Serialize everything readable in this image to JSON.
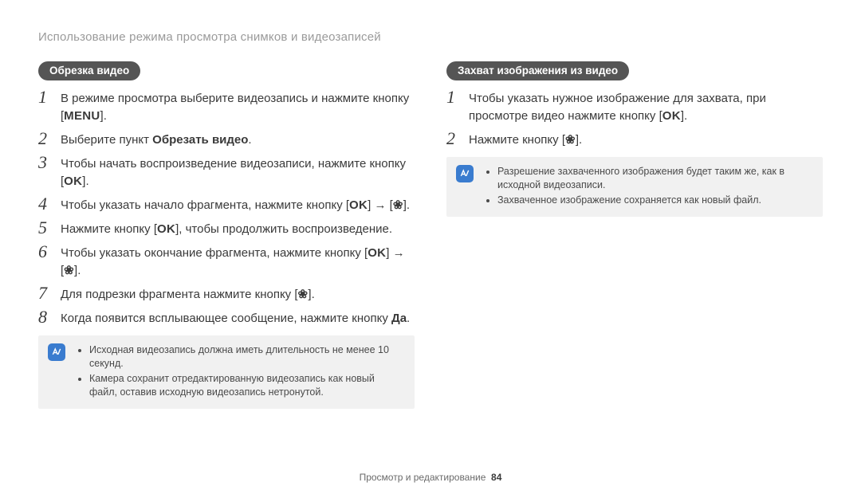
{
  "header": "Использование режима просмотра снимков и видеозаписей",
  "left": {
    "pill": "Обрезка видео",
    "steps": [
      {
        "pre": "В режиме просмотра выберите видеозапись и нажмите кнопку [",
        "icon": "MENU",
        "post": "]."
      },
      {
        "pre": "Выберите пункт ",
        "bold": "Обрезать видео",
        "post": "."
      },
      {
        "pre": "Чтобы начать воспроизведение видеозаписи, нажмите кнопку [",
        "icon": "OK",
        "post": "]."
      },
      {
        "pre": "Чтобы указать начало фрагмента, нажмите кнопку [",
        "icon": "OK",
        "mid": "] → [",
        "icon2": "❀",
        "post": "]."
      },
      {
        "pre": "Нажмите кнопку [",
        "icon": "OK",
        "post": "], чтобы продолжить воспроизведение."
      },
      {
        "pre": "Чтобы указать окончание фрагмента, нажмите кнопку [",
        "icon": "OK",
        "mid": "] → [",
        "icon2": "❀",
        "post": "]."
      },
      {
        "pre": "Для подрезки фрагмента нажмите кнопку [",
        "icon": "❀",
        "post": "]."
      },
      {
        "pre": "Когда появится всплывающее сообщение, нажмите кнопку ",
        "bold": "Да",
        "post": "."
      }
    ],
    "notes": [
      "Исходная видеозапись должна иметь длительность не менее 10 секунд.",
      "Камера сохранит отредактированную видеозапись как новый файл, оставив исходную видеозапись нетронутой."
    ]
  },
  "right": {
    "pill": "Захват изображения из видео",
    "steps": [
      {
        "pre": "Чтобы указать нужное изображение для захвата, при просмотре видео нажмите кнопку [",
        "icon": "OK",
        "post": "]."
      },
      {
        "pre": "Нажмите кнопку [",
        "icon": "❀",
        "post": "]."
      }
    ],
    "notes": [
      "Разрешение захваченного изображения будет таким же, как в исходной видеозаписи.",
      "Захваченное изображение сохраняется как новый файл."
    ]
  },
  "footer": {
    "section": "Просмотр и редактирование",
    "page": "84"
  }
}
